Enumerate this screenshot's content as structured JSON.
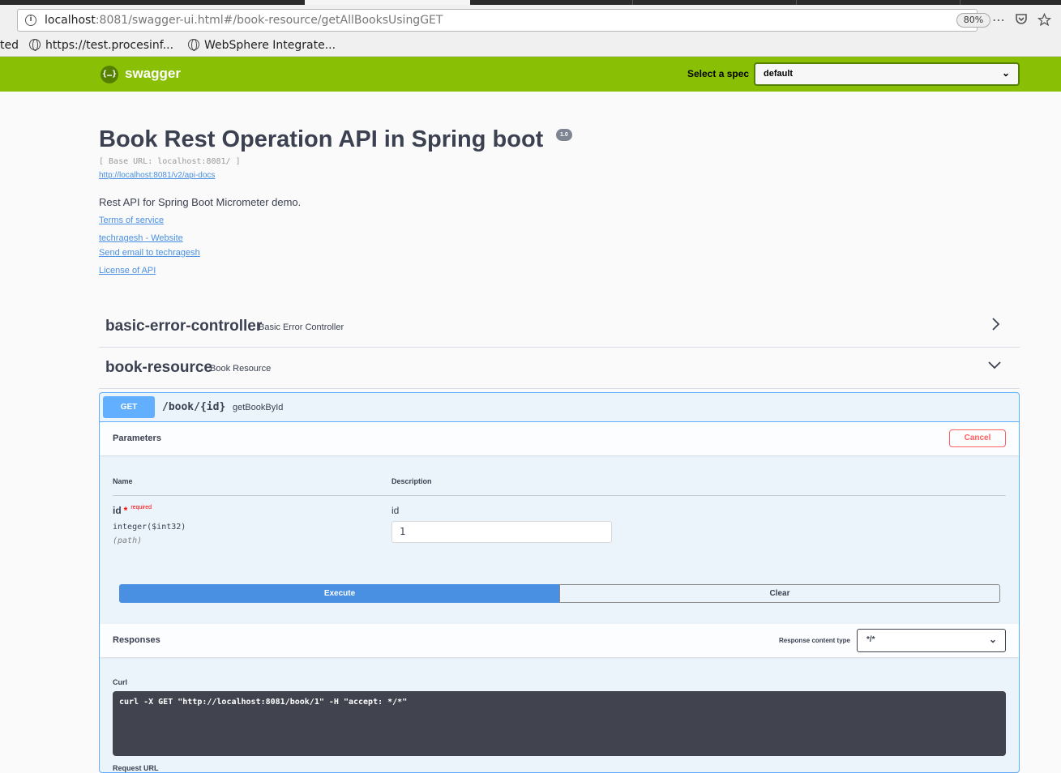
{
  "browser": {
    "url_host": "localhost",
    "url_rest": ":8081/swagger-ui.html#/book-resource/getAllBooksUsingGET",
    "zoom": "80%",
    "bookmarks": [
      {
        "label": "ted"
      },
      {
        "label": "https://test.procesinf..."
      },
      {
        "label": "WebSphere Integrate..."
      }
    ],
    "more_icon": "⋯",
    "pocket_icon": "pocket-icon",
    "star_icon": "star-icon"
  },
  "topbar": {
    "logo_glyph": "{…}",
    "logo_text": "swagger",
    "spec_label": "Select a spec",
    "spec_value": "default",
    "color": "#89bf04"
  },
  "info": {
    "title": "Book Rest Operation API in Spring boot",
    "version": "1.0",
    "base_url": "[ Base URL: localhost:8081/ ]",
    "api_docs": "http://localhost:8081/v2/api-docs",
    "description": "Rest API for Spring Boot Micrometer demo.",
    "links": [
      {
        "label": "Terms of service"
      },
      {
        "label": "techragesh - Website"
      },
      {
        "label": "Send email to techragesh"
      },
      {
        "label": "License of API"
      }
    ]
  },
  "tags": [
    {
      "name": "basic-error-controller",
      "description": "Basic Error Controller",
      "expanded": false
    },
    {
      "name": "book-resource",
      "description": "Book Resource",
      "expanded": true
    }
  ],
  "operation": {
    "method": "GET",
    "path": "/book/{id}",
    "operation_id": "getBookById",
    "parameters_title": "Parameters",
    "cancel_label": "Cancel",
    "col_name": "Name",
    "col_description": "Description",
    "param": {
      "name": "id",
      "star": "*",
      "required": "required",
      "type": "integer($int32)",
      "in": "(path)",
      "description": "id",
      "value": "1"
    },
    "execute_label": "Execute",
    "clear_label": "Clear",
    "responses_title": "Responses",
    "response_content_type_label": "Response content type",
    "response_content_type": "*/*",
    "curl_label": "Curl",
    "curl": "curl -X GET \"http://localhost:8081/book/1\" -H \"accept: */*\"",
    "request_url_label": "Request URL",
    "color": "#61affe"
  }
}
